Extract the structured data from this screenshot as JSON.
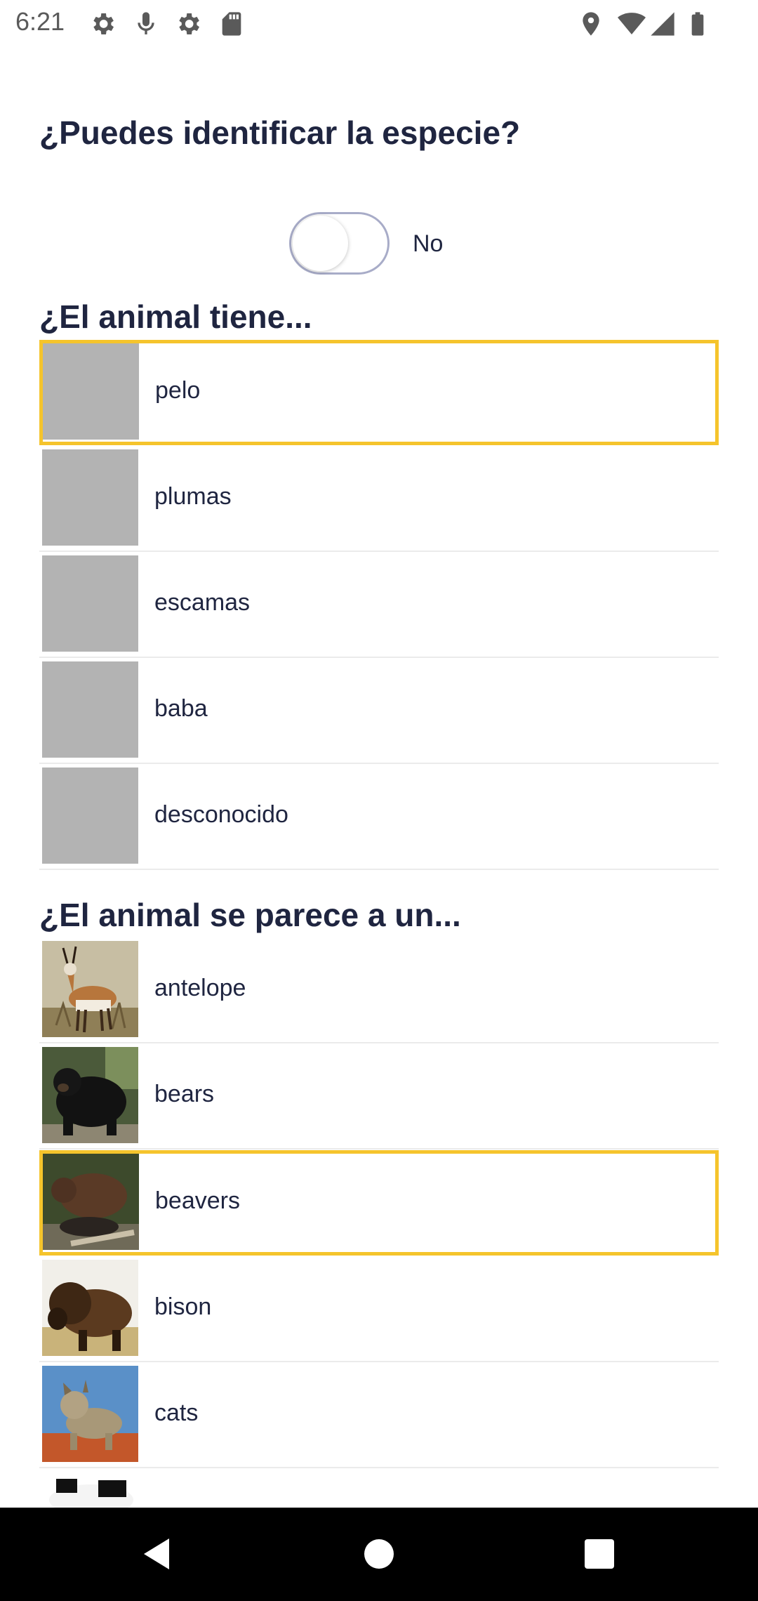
{
  "status_bar": {
    "time": "6:21",
    "left_icons": [
      "settings-icon",
      "mic-icon",
      "settings-icon",
      "sd-card-icon"
    ],
    "right_icons": [
      "location-icon",
      "wifi-icon",
      "signal-icon",
      "battery-icon"
    ]
  },
  "identify": {
    "question": "¿Puedes identificar la especie?",
    "toggle_label": "No",
    "toggle_on": false
  },
  "covering": {
    "title": "¿El animal tiene...",
    "items": [
      {
        "label": "pelo",
        "selected": true
      },
      {
        "label": "plumas",
        "selected": false
      },
      {
        "label": "escamas",
        "selected": false
      },
      {
        "label": "baba",
        "selected": false
      },
      {
        "label": "desconocido",
        "selected": false
      }
    ]
  },
  "resembles": {
    "title": "¿El animal se parece a un...",
    "items": [
      {
        "label": "antelope",
        "selected": false,
        "image": "antelope-photo"
      },
      {
        "label": "bears",
        "selected": false,
        "image": "bear-photo"
      },
      {
        "label": "beavers",
        "selected": true,
        "image": "beaver-photo"
      },
      {
        "label": "bison",
        "selected": false,
        "image": "bison-photo"
      },
      {
        "label": "cats",
        "selected": false,
        "image": "bobcat-photo"
      },
      {
        "label": "",
        "selected": false,
        "image": "cow-photo"
      }
    ]
  },
  "colors": {
    "selection_border": "#f5c42c",
    "heading_text": "#1f2540",
    "placeholder_thumb": "#b3b3b3"
  }
}
